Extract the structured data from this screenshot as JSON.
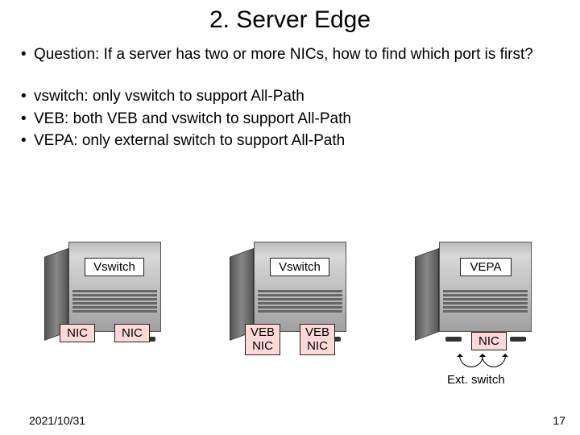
{
  "title": "2. Server Edge",
  "bullets1": [
    "Question: If a server has two or more NICs, how to find which port is first?"
  ],
  "bullets2": [
    "vswitch: only vswitch to support All-Path",
    "VEB: both VEB and vswitch to support All-Path",
    "VEPA: only external switch to support All-Path"
  ],
  "labels": {
    "vswitch": "Vswitch",
    "vepa": "VEPA",
    "nic": "NIC",
    "veb": "VEB",
    "ext_switch": "Ext. switch"
  },
  "footer": {
    "date": "2021/10/31",
    "page": "17"
  }
}
